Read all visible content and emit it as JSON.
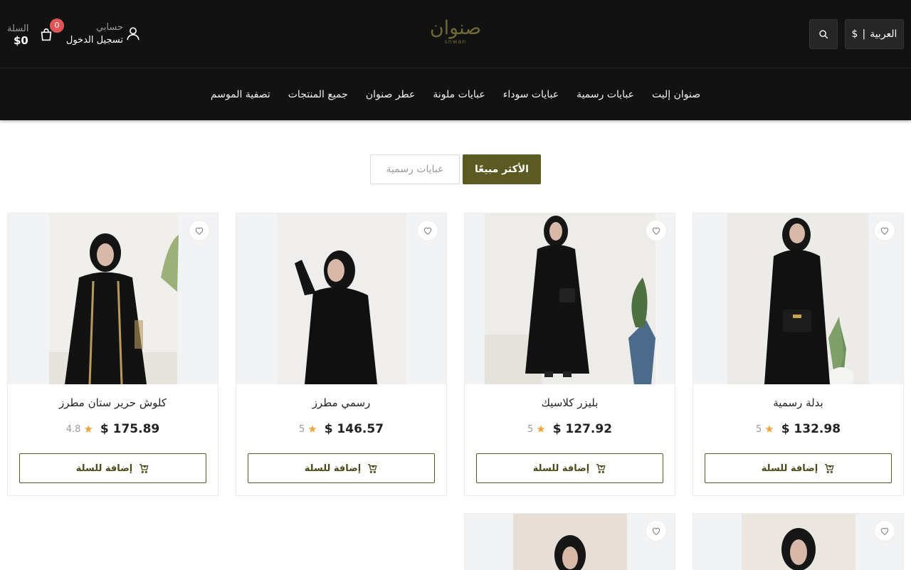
{
  "header": {
    "cart": {
      "label": "السلة",
      "total": "$0",
      "count": "0"
    },
    "account": {
      "title": "حسابي",
      "login": "تسجيل الدخول"
    },
    "logo": {
      "arabic": "صنوان",
      "latin": "snwan"
    },
    "language": {
      "label": "العربية",
      "currency": "$"
    }
  },
  "nav": {
    "items": [
      {
        "label": "صنوان إليت"
      },
      {
        "label": "عبايات رسمية"
      },
      {
        "label": "عبايات سوداء"
      },
      {
        "label": "عبايات ملونة"
      },
      {
        "label": "عطر صنوان"
      },
      {
        "label": "جميع المنتجات"
      },
      {
        "label": "تصفية الموسم"
      }
    ]
  },
  "tabs": {
    "active": "الأكثر مبيعًا",
    "other": "عبايات رسمية"
  },
  "products": [
    {
      "name": "بدلة رسمية",
      "price": "$ 132.98",
      "rating": "5",
      "add_label": "إضافة للسلة"
    },
    {
      "name": "بليزر كلاسيك",
      "price": "$ 127.92",
      "rating": "5",
      "add_label": "إضافة للسلة"
    },
    {
      "name": "رسمي مطرز",
      "price": "$ 146.57",
      "rating": "5",
      "add_label": "إضافة للسلة"
    },
    {
      "name": "كلوش حرير ستان مطرز",
      "price": "$ 175.89",
      "rating": "4.8",
      "add_label": "إضافة للسلة"
    }
  ],
  "colors": {
    "brand": "#5a5a22",
    "header_bg": "#121212",
    "badge": "#e25555",
    "star": "#f0a23b"
  },
  "icons": [
    "cart-icon",
    "user-icon",
    "search-icon",
    "heart-icon",
    "star-icon",
    "add-to-cart-icon"
  ]
}
